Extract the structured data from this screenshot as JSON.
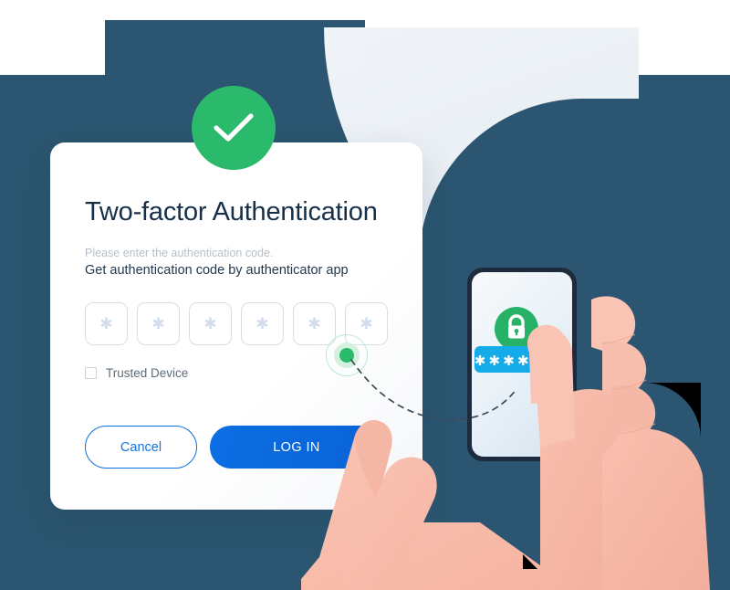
{
  "card": {
    "title": "Two-factor Authentication",
    "subtitle_muted": "Please enter the authentication code.",
    "subtitle_strong": "Get authentication code by authenticator app",
    "code_inputs": [
      {
        "name": "code-digit-1",
        "value": "✱",
        "placeholder": "*"
      },
      {
        "name": "code-digit-2",
        "value": "✱",
        "placeholder": "*"
      },
      {
        "name": "code-digit-3",
        "value": "✱",
        "placeholder": "*"
      },
      {
        "name": "code-digit-4",
        "value": "✱",
        "placeholder": "*"
      },
      {
        "name": "code-digit-5",
        "value": "✱",
        "placeholder": "*"
      },
      {
        "name": "code-digit-6",
        "value": "✱",
        "placeholder": "*"
      }
    ],
    "checkbox": {
      "label": "Trusted Device",
      "checked": false
    },
    "buttons": {
      "cancel": "Cancel",
      "login": "LOG IN"
    }
  },
  "badge": {
    "icon": "check-icon"
  },
  "phone": {
    "lock_icon": "lock-icon",
    "password_mask": "✱ ✱ ✱ ✱ ✱ ✱"
  },
  "annotation": {
    "marker": "green-pointer-dot",
    "path": "dashed-curve-to-phone"
  },
  "colors": {
    "background_dark": "#2B5570",
    "panel_light": "#EDF2F6",
    "accent_green": "#2BBA6C",
    "accent_blue": "#0B6FE3",
    "phone_bar_blue": "#15ABE8",
    "card_white": "#FFFFFF",
    "title_navy": "#16304A",
    "muted_text": "#B6BFC9",
    "skin": "#F8BDAC",
    "skin_dark": "#EFA896"
  }
}
